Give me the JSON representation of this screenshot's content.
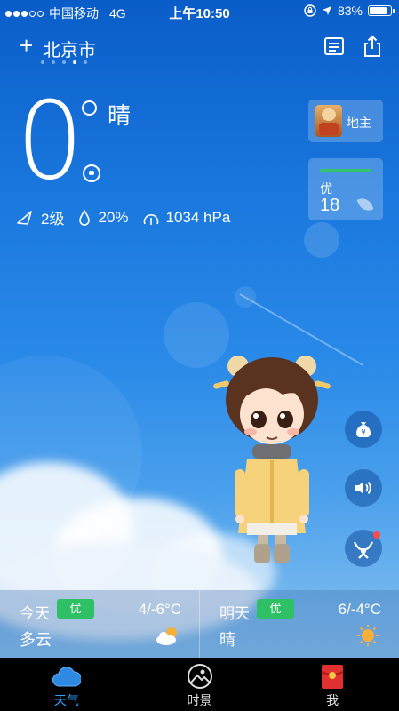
{
  "status_bar": {
    "carrier": "中国移动",
    "network": "4G",
    "time": "上午10:50",
    "battery": "83%",
    "battery_level": 0.83
  },
  "header": {
    "add_symbol": "+",
    "city": "北京市",
    "page_count": 5,
    "active_page": 4
  },
  "current": {
    "temperature": "0",
    "condition": "晴",
    "wind": "2级",
    "humidity": "20%",
    "pressure": "1034 hPa"
  },
  "landlord_card": {
    "label": "地主"
  },
  "air_quality": {
    "level": "优",
    "value": "18",
    "color": "#34c46a"
  },
  "forecast": [
    {
      "day": "今天",
      "aqi": "优",
      "range": "4/-6°C",
      "condition": "多云",
      "icon": "partly-cloudy-icon"
    },
    {
      "day": "明天",
      "aqi": "优",
      "range": "6/-4°C",
      "condition": "晴",
      "icon": "sun-icon"
    }
  ],
  "tabs": [
    {
      "label": "天气",
      "icon": "cloud-icon",
      "active": true
    },
    {
      "label": "时景",
      "icon": "photo-icon",
      "active": false
    },
    {
      "label": "我",
      "icon": "red-envelope-icon",
      "active": false
    }
  ],
  "colors": {
    "accent": "#2ea0ff",
    "aqi_good": "#2fbf64",
    "notification": "#ff4a4a"
  }
}
